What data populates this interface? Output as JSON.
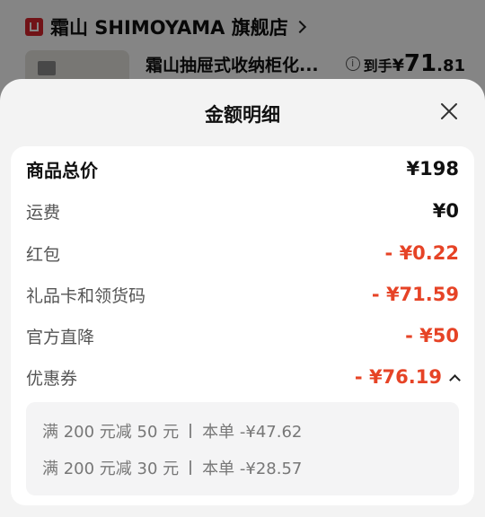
{
  "store": {
    "name": "霜山 SHIMOYAMA 旗舰店"
  },
  "product": {
    "title": "霜山抽屉式收纳柜化...",
    "price_label": "到手",
    "price_symbol": "¥",
    "price_int": "71",
    "price_dec": ".81"
  },
  "sheet": {
    "title": "金额明细",
    "rows": [
      {
        "label": "商品总价",
        "value": "¥198"
      },
      {
        "label": "运费",
        "value": "¥0"
      },
      {
        "label": "红包",
        "value": "- ¥0.22"
      },
      {
        "label": "礼品卡和领货码",
        "value": "- ¥71.59"
      },
      {
        "label": "官方直降",
        "value": "- ¥50"
      },
      {
        "label": "优惠券",
        "value": "- ¥76.19"
      }
    ],
    "coupon_details": [
      {
        "rule": "满 200 元减 50 元",
        "amount": "本单 -¥47.62"
      },
      {
        "rule": "满 200 元减 30 元",
        "amount": "本单 -¥28.57"
      }
    ]
  },
  "colors": {
    "discount_red": "#e64326",
    "store_logo_red": "#d9262c"
  },
  "icons": [
    "store-logo-icon",
    "chevron-right-icon",
    "info-icon",
    "close-icon",
    "chevron-up-icon"
  ]
}
